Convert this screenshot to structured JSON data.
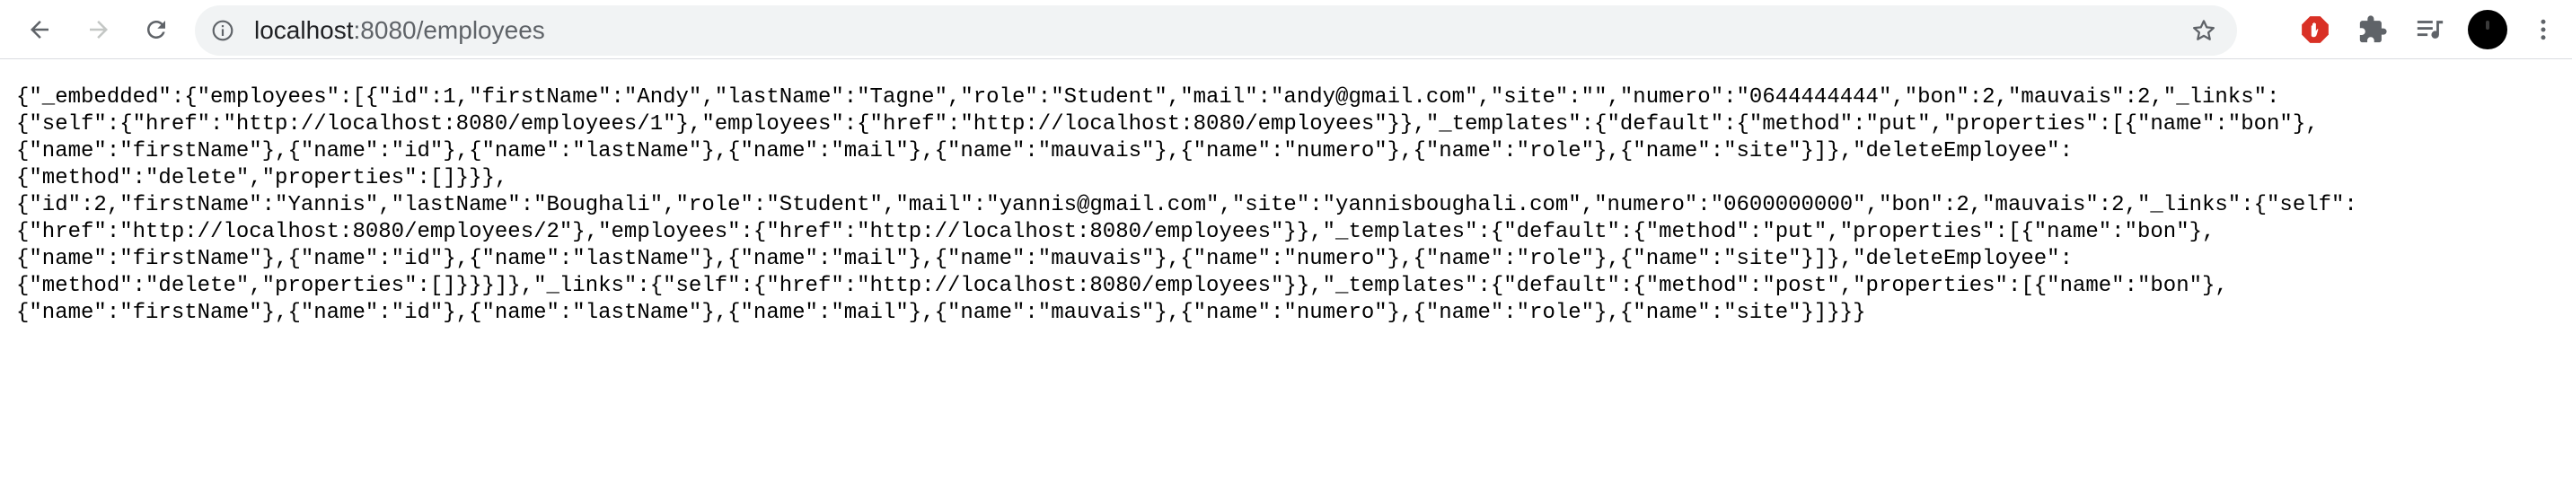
{
  "browser": {
    "url_host": "localhost",
    "url_rest": ":8080/employees",
    "icons": {
      "back": "arrow-left-icon",
      "forward": "arrow-right-icon",
      "reload": "reload-icon",
      "site_info": "info-icon",
      "bookmark": "star-icon",
      "ext_adblock": "stop-hand-icon",
      "ext_puzzle": "puzzle-icon",
      "media": "playlist-icon",
      "menu": "kebab-menu-icon"
    },
    "colors": {
      "adblock": "#d93025",
      "icon": "#5f6368",
      "omnibox_bg": "#f1f3f4"
    }
  },
  "page": {
    "lines": [
      "{\"_embedded\":{\"employees\":[{\"id\":1,\"firstName\":\"Andy\",\"lastName\":\"Tagne\",\"role\":\"Student\",\"mail\":\"andy@gmail.com\",\"site\":\"\",\"numero\":\"0644444444\",\"bon\":2,\"mauvais\":2,\"_links\":",
      "{\"self\":{\"href\":\"http://localhost:8080/employees/1\"},\"employees\":{\"href\":\"http://localhost:8080/employees\"}},\"_templates\":{\"default\":{\"method\":\"put\",\"properties\":[{\"name\":\"bon\"},",
      "{\"name\":\"firstName\"},{\"name\":\"id\"},{\"name\":\"lastName\"},{\"name\":\"mail\"},{\"name\":\"mauvais\"},{\"name\":\"numero\"},{\"name\":\"role\"},{\"name\":\"site\"}]},\"deleteEmployee\":",
      "{\"method\":\"delete\",\"properties\":[]}}},",
      "{\"id\":2,\"firstName\":\"Yannis\",\"lastName\":\"Boughali\",\"role\":\"Student\",\"mail\":\"yannis@gmail.com\",\"site\":\"yannisboughali.com\",\"numero\":\"0600000000\",\"bon\":2,\"mauvais\":2,\"_links\":{\"self\":",
      "{\"href\":\"http://localhost:8080/employees/2\"},\"employees\":{\"href\":\"http://localhost:8080/employees\"}},\"_templates\":{\"default\":{\"method\":\"put\",\"properties\":[{\"name\":\"bon\"},",
      "{\"name\":\"firstName\"},{\"name\":\"id\"},{\"name\":\"lastName\"},{\"name\":\"mail\"},{\"name\":\"mauvais\"},{\"name\":\"numero\"},{\"name\":\"role\"},{\"name\":\"site\"}]},\"deleteEmployee\":",
      "{\"method\":\"delete\",\"properties\":[]}}}]},\"_links\":{\"self\":{\"href\":\"http://localhost:8080/employees\"}},\"_templates\":{\"default\":{\"method\":\"post\",\"properties\":[{\"name\":\"bon\"},",
      "{\"name\":\"firstName\"},{\"name\":\"id\"},{\"name\":\"lastName\"},{\"name\":\"mail\"},{\"name\":\"mauvais\"},{\"name\":\"numero\"},{\"name\":\"role\"},{\"name\":\"site\"}]}}}"
    ]
  }
}
